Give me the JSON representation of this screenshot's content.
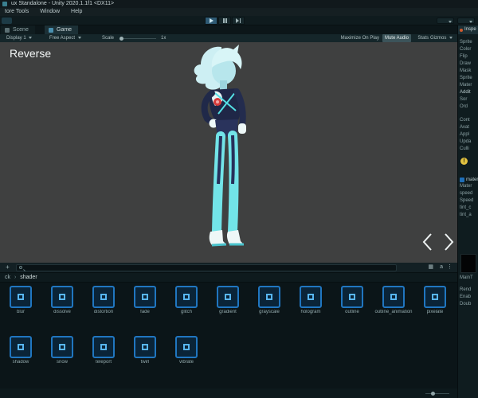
{
  "window": {
    "title": "ux Standalone - Unity 2020.1.1f1 <DX11>"
  },
  "menu": {
    "items": [
      "tore Tools",
      "Window",
      "Help"
    ]
  },
  "tabs": {
    "scene": "Scene",
    "game": "Game"
  },
  "game_bar": {
    "display": "Display 1",
    "aspect": "Free Aspect",
    "scale_label": "Scale",
    "scale_value": "1x",
    "maximize": "Maximize On Play",
    "mute_audio": "Mute Audio",
    "stats": "Stats",
    "gizmos": "Gizmos"
  },
  "viewport": {
    "overlay": "Reverse"
  },
  "project": {
    "search_value": "",
    "breadcrumb": [
      "ck",
      "shader"
    ],
    "breadcrumb_sep": "›",
    "assets_row1": [
      "blur",
      "dissolve",
      "distortion",
      "fade",
      "glitch",
      "gradient",
      "grayscale",
      "hologram",
      "outline",
      "outline_animation",
      "pixelate"
    ],
    "assets_row2": [
      "shadow",
      "snow",
      "teleport",
      "twirl",
      "vibrate"
    ]
  },
  "inspector": {
    "tab": "Inspe",
    "rows_sprite": [
      "Sprite",
      "Color",
      "Flip",
      "Draw",
      "Mask",
      "Sprite",
      "Mater",
      "Addit",
      "Sor",
      "Ord"
    ],
    "rows_animator": [
      "Cont",
      "Avat",
      "Appl",
      "Upda",
      "Culli"
    ],
    "warning_glyph": "!",
    "component_name": "mater",
    "rows_material": [
      "Mater",
      "speed",
      "Speed",
      "tint_c",
      "tint_a"
    ],
    "preview_label": "MainT",
    "rows_render": [
      "Rend",
      "Enab",
      "Doub"
    ]
  },
  "icons": {
    "lock": "a",
    "menu": "⋮",
    "plus": "+"
  },
  "colors": {
    "accent_blue": "#2076c0",
    "play_highlight": "#2e5a74",
    "warning_yellow": "#e2c341",
    "emblem_red": "#d63b3b"
  }
}
